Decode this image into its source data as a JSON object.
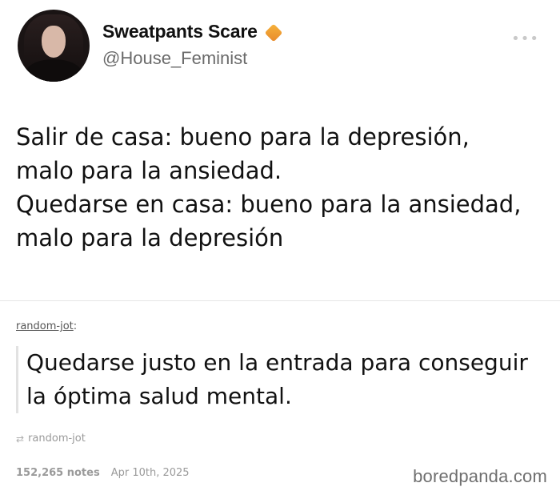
{
  "tweet": {
    "display_name": "Sweatpants Scare",
    "handle": "@House_Feminist",
    "more_icon": "more-horizontal-icon",
    "badge_color": "#f0a232",
    "text": "Salir de casa: bueno para la depresión,\nmalo para la ansiedad.\nQuedarse en casa: bueno para la ansiedad,\nmalo para la depresión"
  },
  "reply": {
    "reblogger": "random-jot",
    "reblogger_suffix": ":",
    "quote_text": "Quedarse justo en la entrada para conseguir\nla óptima salud mental.",
    "source_icon": "reblog-icon",
    "source_name": "random-jot",
    "notes": "152,265 notes",
    "date": "Apr 10th, 2025"
  },
  "watermark": "boredpanda.com"
}
